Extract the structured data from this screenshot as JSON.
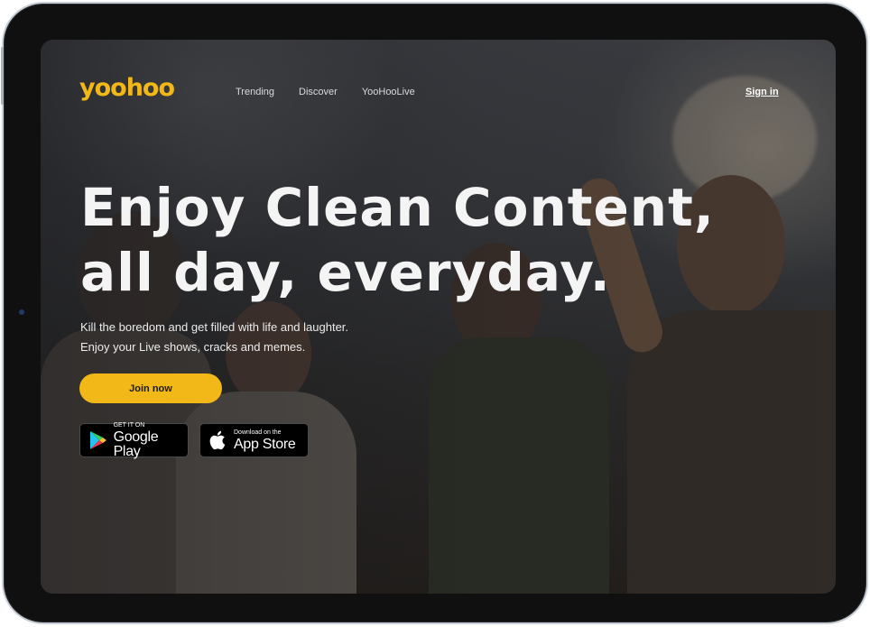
{
  "brand": {
    "logo_text": "yoohoo",
    "accent_color": "#f2b817"
  },
  "nav": {
    "items": [
      {
        "label": "Trending"
      },
      {
        "label": "Discover"
      },
      {
        "label": "YooHooLive"
      }
    ],
    "sign_in": "Sign in"
  },
  "hero": {
    "headline_line1": "Enjoy Clean Content,",
    "headline_line2": "all day, everyday.",
    "sub_line1": "Kill the boredom and get filled with life and laughter.",
    "sub_line2": "Enjoy your Live shows, cracks and memes.",
    "cta_label": "Join now"
  },
  "stores": {
    "google": {
      "small": "GET IT ON",
      "big": "Google Play",
      "icon": "google-play-icon"
    },
    "apple": {
      "small": "Download on the",
      "big": "App Store",
      "icon": "apple-icon"
    }
  }
}
